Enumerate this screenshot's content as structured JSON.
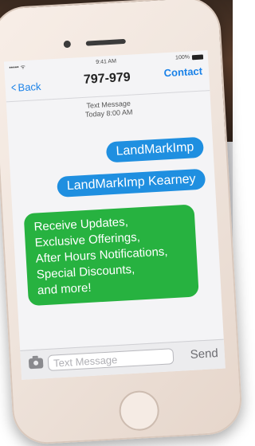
{
  "status": {
    "signal": "••••• ᯤ",
    "time": "9:41 AM",
    "battery": "100%"
  },
  "nav": {
    "back_label": "Back",
    "title": "797-979",
    "contact_label": "Contact"
  },
  "meta": {
    "type": "Text Message",
    "timestamp": "Today 8:00 AM"
  },
  "messages": {
    "blue": [
      "LandMarkImp",
      "LandMarkImp Kearney"
    ],
    "green": [
      "Receive Updates,",
      "Exclusive Offerings,",
      "After Hours Notifications,",
      "Special Discounts,",
      "and more!"
    ]
  },
  "composer": {
    "placeholder": "Text Message",
    "value": "",
    "send_label": "Send"
  },
  "colors": {
    "ios_blue": "#1a82e8",
    "bubble_blue": "#1f8fe0",
    "bubble_green": "#27b240"
  }
}
